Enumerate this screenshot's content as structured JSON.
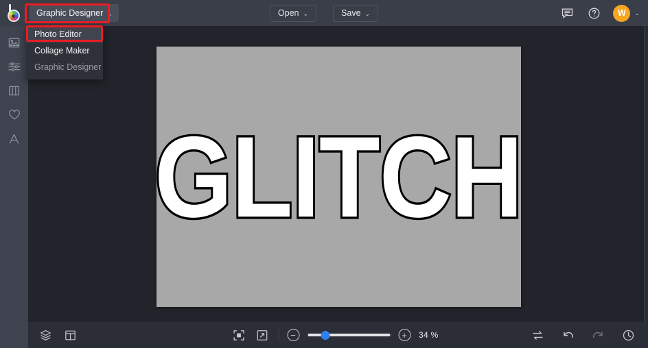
{
  "app": {
    "logo_name": "befunky-logo",
    "accent_blue": "#2f80ed",
    "avatar_color": "#f5a623",
    "annotation_color": "#ec1c24"
  },
  "topbar": {
    "mode_button": {
      "label": "Graphic Designer",
      "chevron": "⌄"
    },
    "open_button": {
      "label": "Open",
      "chevron": "⌄"
    },
    "save_button": {
      "label": "Save",
      "chevron": "⌄"
    },
    "feedback_icon": "chat-bubble-icon",
    "help_icon": "question-circle-icon",
    "avatar": {
      "initial": "W",
      "chevron": "⌄"
    }
  },
  "dropdown": {
    "open": true,
    "items": [
      {
        "label": "Photo Editor",
        "state": "highlighted"
      },
      {
        "label": "Collage Maker",
        "state": "normal"
      },
      {
        "label": "Graphic Designer",
        "state": "disabled"
      }
    ]
  },
  "sidebar": {
    "items": [
      {
        "name": "image-tool",
        "icon": "image-icon"
      },
      {
        "name": "adjust-tool",
        "icon": "sliders-icon"
      },
      {
        "name": "layout-tool",
        "icon": "columns-icon"
      },
      {
        "name": "favorites-tool",
        "icon": "heart-icon"
      },
      {
        "name": "text-tool",
        "icon": "letter-a-icon"
      }
    ]
  },
  "canvas": {
    "text": "GLITCH",
    "background_color": "#a8a8a8",
    "text_fill": "#ffffff",
    "text_stroke": "#000000"
  },
  "bottombar": {
    "layers_icon": "layers-icon",
    "panels_icon": "panel-layout-icon",
    "fit_icon": "fit-to-screen-icon",
    "fullscreen_icon": "expand-icon",
    "zoom_out_label": "−",
    "zoom_in_label": "+",
    "zoom_value": "34 %",
    "zoom_percent": 34,
    "compare_icon": "compare-swap-icon",
    "undo_icon": "undo-icon",
    "redo_icon": "redo-icon",
    "history_icon": "history-clock-icon"
  }
}
